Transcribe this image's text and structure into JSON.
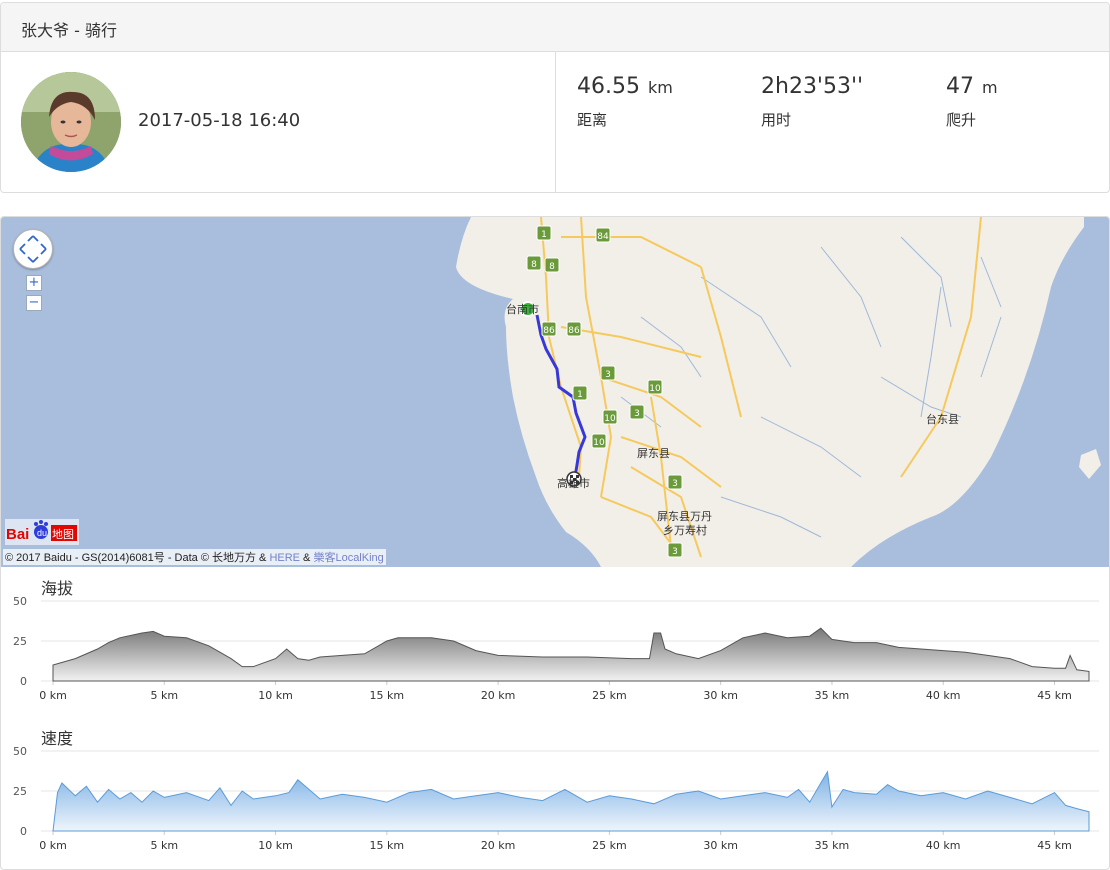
{
  "header": {
    "title": "张大爷 - 骑行"
  },
  "profile": {
    "datetime": "2017-05-18 16:40"
  },
  "stats": [
    {
      "value": "46.55",
      "unit": "km",
      "label": "距离"
    },
    {
      "value": "2h23'53''",
      "unit": "",
      "label": "用时"
    },
    {
      "value": "47",
      "unit": "m",
      "label": "爬升"
    }
  ],
  "map": {
    "zoom_in": "+",
    "zoom_out": "−",
    "logo_text": "Bai地图",
    "attribution": {
      "prefix": "© 2017 Baidu - GS(2014)6081号 - Data © 长地万方 & ",
      "here": "HERE",
      "amp": " & ",
      "localking": "樂客LocalKing"
    },
    "place_labels": [
      "台南市",
      "屏东县",
      "台东县",
      "高雄市",
      "屏东县万丹",
      "乡万寿村"
    ],
    "road_shields": [
      "1",
      "84",
      "8",
      "8",
      "86",
      "86",
      "3",
      "10",
      "1",
      "10",
      "3",
      "10",
      "3",
      "3"
    ]
  },
  "colors": {
    "route": "#3838d8",
    "start": "#3db13d",
    "elevation": "#888888",
    "speed": "#9ec4ea"
  },
  "chart_data": [
    {
      "type": "area",
      "title": "海拔",
      "xlabel": "",
      "ylabel": "",
      "x_ticks": [
        "0 km",
        "5 km",
        "10 km",
        "15 km",
        "20 km",
        "25 km",
        "30 km",
        "35 km",
        "40 km",
        "45 km"
      ],
      "y_ticks": [
        "0",
        "25",
        "50"
      ],
      "xlim": [
        0,
        46.55
      ],
      "ylim": [
        0,
        50
      ],
      "grid": true,
      "x": [
        0,
        1,
        2,
        2.5,
        3,
        4,
        4.5,
        5,
        6,
        7,
        8,
        8.5,
        9,
        10,
        10.5,
        11,
        11.5,
        12,
        13,
        14,
        15,
        15.5,
        16,
        17,
        18,
        19,
        20,
        22,
        24,
        26,
        26.8,
        27,
        27.3,
        27.5,
        28,
        29,
        30,
        31,
        32,
        33,
        34,
        34.5,
        35,
        36,
        37,
        38,
        39,
        40,
        41,
        42,
        43,
        44,
        45,
        45.5,
        45.7,
        46,
        46.55
      ],
      "series": [
        {
          "values": [
            10,
            14,
            20,
            24,
            27,
            30,
            31,
            28,
            27,
            22,
            14,
            9,
            9,
            14,
            20,
            14,
            13,
            15,
            16,
            17,
            25,
            27,
            27,
            27,
            25,
            19,
            16,
            15,
            15,
            14,
            14,
            30,
            30,
            20,
            17,
            14,
            19,
            27,
            30,
            27,
            28,
            33,
            26,
            24,
            24,
            21,
            20,
            19,
            18,
            16,
            14,
            9,
            8,
            8,
            16,
            7,
            6
          ]
        }
      ]
    },
    {
      "type": "area",
      "title": "速度",
      "xlabel": "",
      "ylabel": "",
      "x_ticks": [
        "0 km",
        "5 km",
        "10 km",
        "15 km",
        "20 km",
        "25 km",
        "30 km",
        "35 km",
        "40 km",
        "45 km"
      ],
      "y_ticks": [
        "0",
        "25",
        "50"
      ],
      "xlim": [
        0,
        46.55
      ],
      "ylim": [
        0,
        50
      ],
      "grid": true,
      "x": [
        0,
        0.2,
        0.4,
        1,
        1.5,
        2,
        2.5,
        3,
        3.5,
        4,
        4.5,
        5,
        6,
        7,
        7.5,
        8,
        8.5,
        9,
        10,
        10.6,
        11,
        12,
        13,
        14,
        15,
        16,
        17,
        18,
        19,
        20,
        21,
        22,
        23,
        24,
        25,
        26,
        27,
        28,
        29,
        30,
        31,
        32,
        33,
        33.5,
        34,
        34.5,
        34.8,
        35,
        35.5,
        36,
        37,
        37.5,
        38,
        39,
        40,
        41,
        42,
        43,
        44,
        45,
        45.5,
        46,
        46.55
      ],
      "series": [
        {
          "values": [
            0,
            24,
            30,
            22,
            28,
            18,
            26,
            20,
            24,
            18,
            25,
            21,
            24,
            19,
            27,
            16,
            25,
            20,
            22,
            24,
            32,
            20,
            23,
            21,
            18,
            24,
            26,
            20,
            22,
            24,
            21,
            19,
            26,
            18,
            22,
            20,
            17,
            23,
            25,
            20,
            22,
            24,
            21,
            26,
            18,
            30,
            37,
            15,
            26,
            24,
            23,
            29,
            25,
            22,
            24,
            20,
            25,
            21,
            17,
            24,
            16,
            14,
            12
          ]
        }
      ]
    }
  ]
}
